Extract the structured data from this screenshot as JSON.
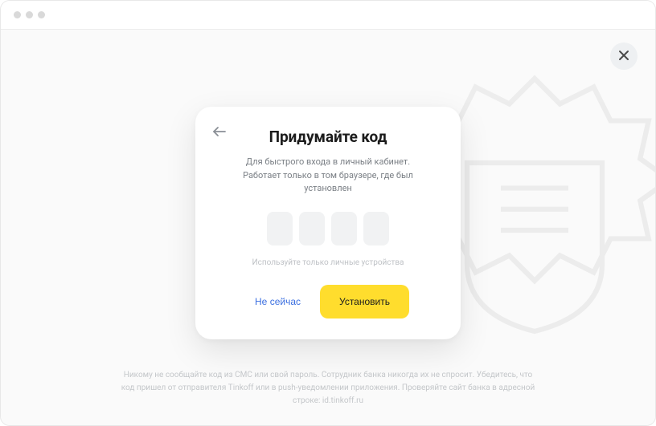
{
  "modal": {
    "title": "Придумайте код",
    "subtitle": "Для быстрого входа в личный кабинет. Работает только в том браузере, где был установлен",
    "hint": "Используйте только личные устройства",
    "actions": {
      "skip": "Не сейчас",
      "confirm": "Установить"
    },
    "code": [
      "",
      "",
      "",
      ""
    ]
  },
  "footer": {
    "text": "Никому не сообщайте код из СМС или свой пароль. Сотрудник банка никогда их не спросит. Убедитесь, что код пришел от отправителя Tinkoff или в push-уведомлении приложения. Проверяйте сайт банка в адресной строке: id.tinkoff.ru"
  }
}
